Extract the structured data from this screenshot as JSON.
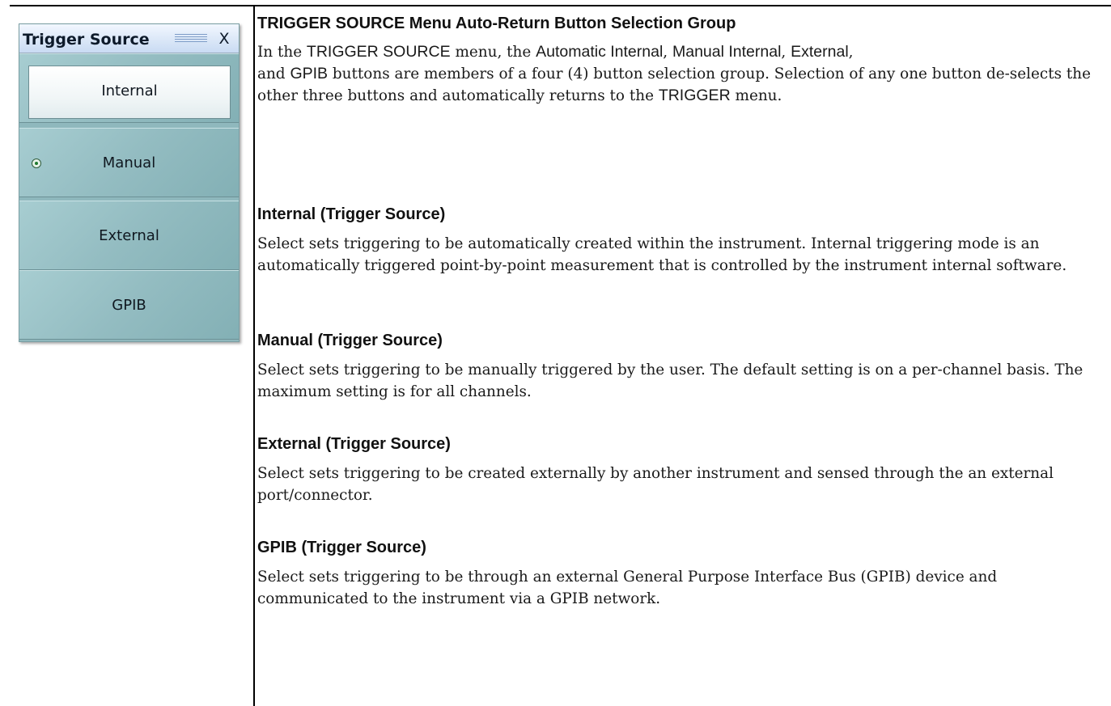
{
  "menu": {
    "title": "Trigger Source",
    "close_label": "X",
    "buttons": [
      {
        "label": "Internal"
      },
      {
        "label": "Manual"
      },
      {
        "label": "External"
      },
      {
        "label": "GPIB"
      }
    ],
    "highlighted_button": "Internal",
    "radio_selected_button": "Manual"
  },
  "content": {
    "section_heading": "TRIGGER SOURCE Menu Auto-Return Button Selection Group",
    "intro": {
      "t1": "In the ",
      "s1": "TRIGGER SOURCE",
      "t2": " menu, the ",
      "s2": "Automatic Internal",
      "t3": ", ",
      "s3": "Manual Internal",
      "t4": ", ",
      "s4": "External",
      "t5": ",",
      "t6": "and ",
      "s5": "GPIB",
      "t7": " buttons are members of a four (4) button selection group. Selection of any one button de-selects the other three buttons and automatically returns to the ",
      "s6": "TRIGGER",
      "t8": " menu."
    },
    "items": [
      {
        "heading": "Internal (Trigger Source)",
        "text": "Select sets triggering to be automatically created within the instrument. Internal triggering mode is an automatically triggered point-by-point measurement that is controlled by the instrument internal software."
      },
      {
        "heading": "Manual (Trigger Source)",
        "text": "Select sets triggering to be manually triggered by the user. The default setting is on a per-channel basis. The maximum setting is for all channels."
      },
      {
        "heading": "External (Trigger Source)",
        "text": "Select sets triggering to be created externally by another instrument and sensed through the an external port/connector."
      },
      {
        "heading": "GPIB (Trigger Source)",
        "text": "Select sets triggering to be through an external General Purpose Interface Bus (GPIB) device and communicated to the instrument via a GPIB network."
      }
    ]
  }
}
